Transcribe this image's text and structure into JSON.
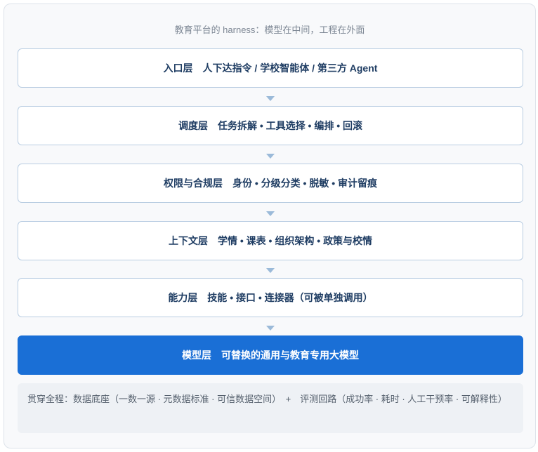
{
  "caption": "教育平台的 harness：模型在中间，工程在外面",
  "layers": [
    {
      "label": "入口层　人下达指令 / 学校智能体 / 第三方 Agent"
    },
    {
      "label": "调度层　任务拆解 • 工具选择 • 编排 • 回滚"
    },
    {
      "label": "权限与合规层　身份 • 分级分类 • 脱敏 • 审计留痕"
    },
    {
      "label": "上下文层　学情 • 课表 • 组织架构 • 政策与校情"
    },
    {
      "label": "能力层　技能 • 接口 • 连接器（可被单独调用）"
    },
    {
      "label": "模型层　可替换的通用与教育专用大模型"
    }
  ],
  "footer": "贯穿全程：数据底座（一数一源 · 元数据标准 · 可信数据空间）　+　评测回路（成功率 · 耗时 · 人工干预率 · 可解释性）",
  "colors": {
    "highlight": "#1a6fd6",
    "layer_text": "#1f3d63",
    "arrow": "#9bbad9"
  }
}
